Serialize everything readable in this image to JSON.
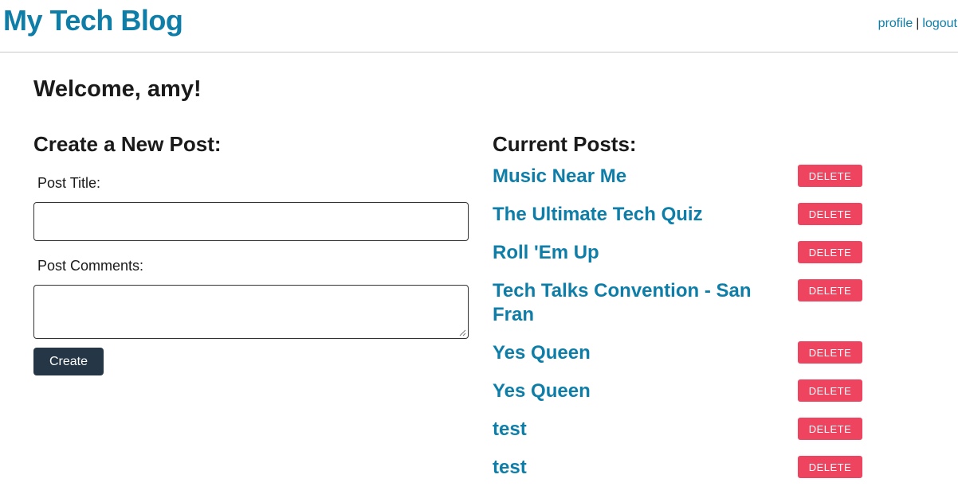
{
  "header": {
    "site_title": "My Tech Blog",
    "nav": {
      "profile_label": "profile",
      "separator": "|",
      "logout_label": "logout"
    }
  },
  "welcome": "Welcome, amy!",
  "create_form": {
    "heading": "Create a New Post:",
    "title_label": "Post Title:",
    "title_value": "",
    "comments_label": "Post Comments:",
    "comments_value": "",
    "submit_label": "Create"
  },
  "posts": {
    "heading": "Current Posts:",
    "delete_label": "DELETE",
    "items": [
      {
        "title": "Music Near Me"
      },
      {
        "title": "The Ultimate Tech Quiz"
      },
      {
        "title": "Roll 'Em Up"
      },
      {
        "title": "Tech Talks Convention - San Fran"
      },
      {
        "title": "Yes Queen"
      },
      {
        "title": "Yes Queen"
      },
      {
        "title": "test"
      },
      {
        "title": "test"
      }
    ]
  },
  "colors": {
    "brand": "#0e7ea8",
    "delete": "#ee4460",
    "create_button": "#253747"
  }
}
